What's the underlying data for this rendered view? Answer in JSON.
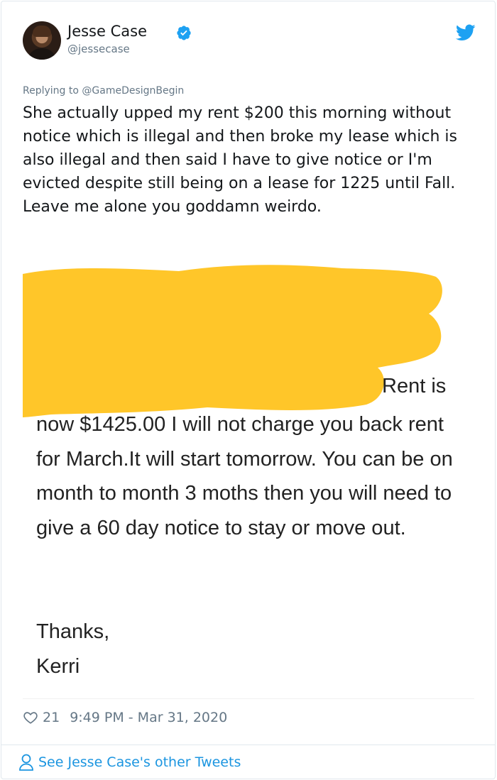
{
  "author": {
    "name": "Jesse Case",
    "handle": "@jessecase"
  },
  "replying": {
    "prefix": "Replying to",
    "mention": "@GameDesignBegin"
  },
  "tweet": {
    "text": "She actually upped my rent $200 this morning without notice which is illegal and then broke my lease which is also illegal and then said I have to give notice or I'm evicted despite still being on a lease for 1225 until Fall. Leave me alone you goddamn weirdo."
  },
  "media": {
    "rent_is": "Rent is",
    "body": "now $1425.00 I will not charge you back rent for March.It will start tomorrow. You can be on month to month 3 moths then you will need to give a 60 day notice to stay or move out.",
    "signoff_line1": "Thanks,",
    "signoff_line2": "Kerri",
    "redaction_color": "#ffc629"
  },
  "footer": {
    "likes": "21",
    "timestamp": "9:49 PM - Mar 31, 2020",
    "see_more": "See Jesse Case's other Tweets"
  },
  "colors": {
    "twitter_blue": "#1da1f2",
    "link_blue": "#1b95e0",
    "muted": "#657786"
  },
  "icons": {
    "avatar": "avatar",
    "verified": "verified-badge-icon",
    "bird": "twitter-bird-icon",
    "heart": "heart-icon",
    "person": "person-icon"
  }
}
